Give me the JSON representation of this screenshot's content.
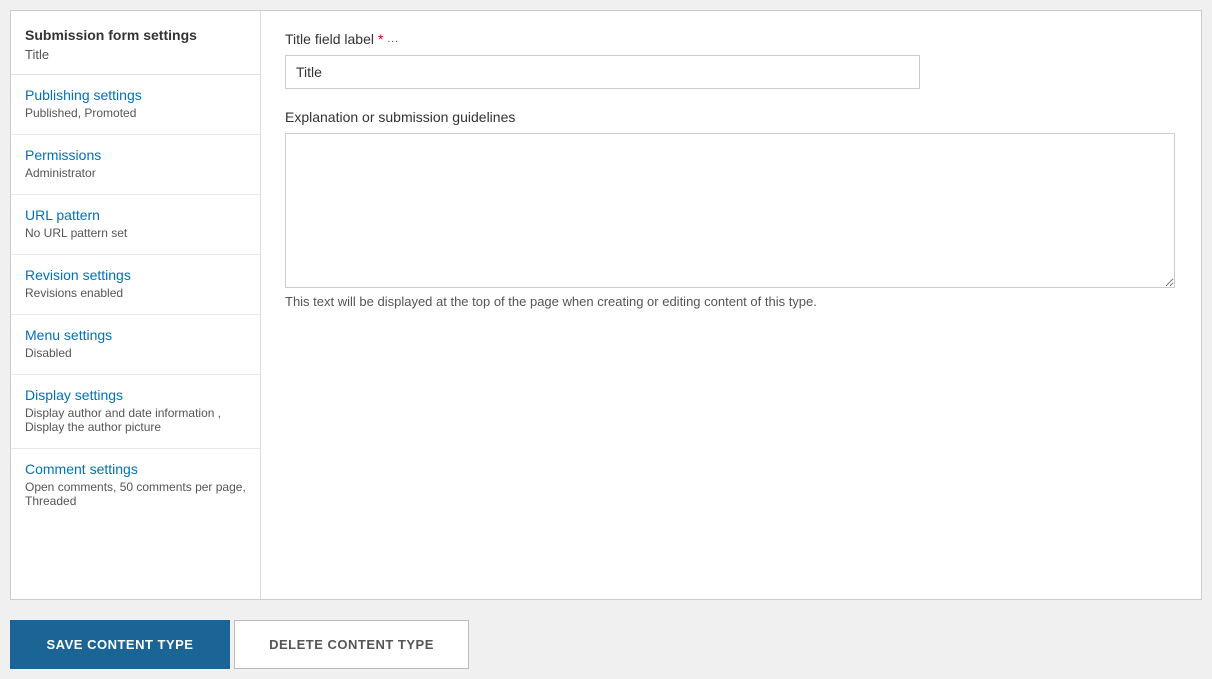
{
  "sidebar": {
    "header": "Submission form settings",
    "subtitle": "Title",
    "items": [
      {
        "id": "publishing-settings",
        "title": "Publishing settings",
        "desc": "Published, Promoted"
      },
      {
        "id": "permissions",
        "title": "Permissions",
        "desc": "Administrator"
      },
      {
        "id": "url-pattern",
        "title": "URL pattern",
        "desc": "No URL pattern set"
      },
      {
        "id": "revision-settings",
        "title": "Revision settings",
        "desc": "Revisions enabled"
      },
      {
        "id": "menu-settings",
        "title": "Menu settings",
        "desc": "Disabled"
      },
      {
        "id": "display-settings",
        "title": "Display settings",
        "desc": "Display author and date information , Display the author picture"
      },
      {
        "id": "comment-settings",
        "title": "Comment settings",
        "desc": "Open comments, 50 comments per page, Threaded"
      }
    ]
  },
  "form": {
    "title_field_label": "Title field label",
    "required_mark": "*",
    "required_dots": "...",
    "title_input_value": "Title",
    "explanation_label": "Explanation or submission guidelines",
    "explanation_placeholder": "",
    "hint_text": "This text will be displayed at the top of the page when creating or editing content of this type."
  },
  "footer": {
    "save_label": "SAVE CONTENT TYPE",
    "delete_label": "DELETE CONTENT TYPE"
  }
}
